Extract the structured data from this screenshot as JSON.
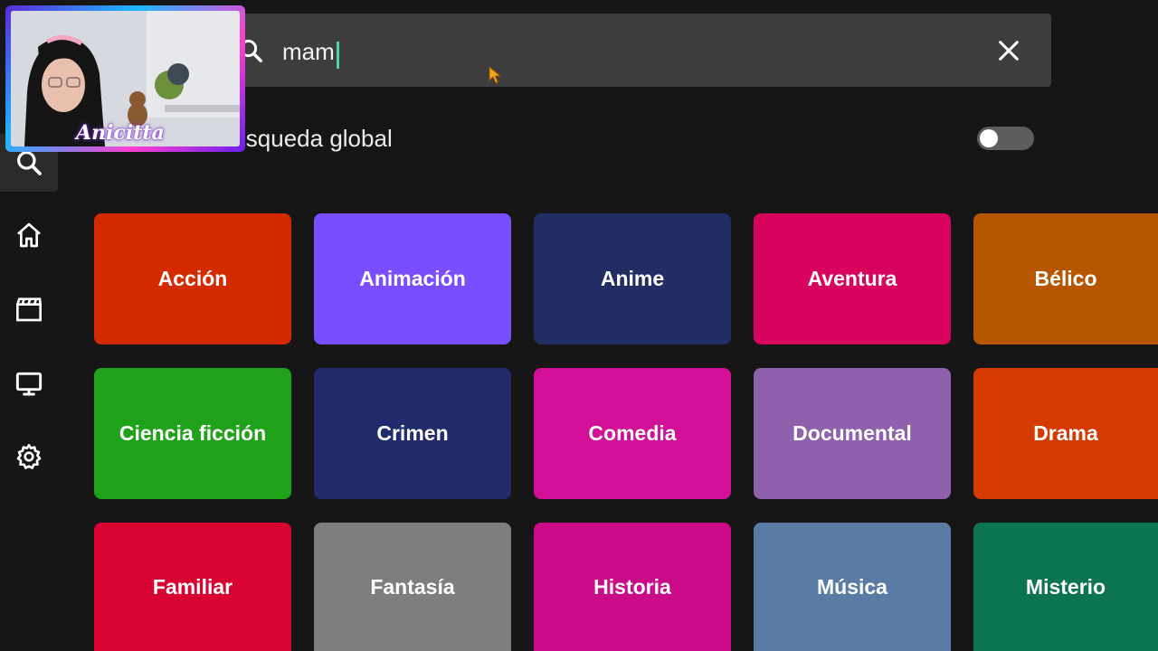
{
  "sidebar": {
    "items": [
      {
        "name": "search",
        "icon": "search-icon",
        "active": true
      },
      {
        "name": "home",
        "icon": "home-icon",
        "active": false
      },
      {
        "name": "movies",
        "icon": "clapperboard-icon",
        "active": false
      },
      {
        "name": "tv",
        "icon": "monitor-icon",
        "active": false
      },
      {
        "name": "settings",
        "icon": "gear-icon",
        "active": false
      }
    ]
  },
  "search": {
    "value": "mam",
    "icon": "search-icon",
    "clear_icon": "close-icon"
  },
  "global_search": {
    "label": "Búsqueda global",
    "enabled": false
  },
  "genres": [
    {
      "label": "Acción",
      "color": "#d42a00"
    },
    {
      "label": "Animación",
      "color": "#7a4dff"
    },
    {
      "label": "Anime",
      "color": "#222e63"
    },
    {
      "label": "Aventura",
      "color": "#d8035c"
    },
    {
      "label": "Bélico",
      "color": "#b65600"
    },
    {
      "label": "Ciencia ficción",
      "color": "#1fa21a"
    },
    {
      "label": "Crimen",
      "color": "#222b6c"
    },
    {
      "label": "Comedia",
      "color": "#d20f97"
    },
    {
      "label": "Documental",
      "color": "#8f61ad"
    },
    {
      "label": "Drama",
      "color": "#d53b00"
    },
    {
      "label": "Familiar",
      "color": "#d80332"
    },
    {
      "label": "Fantasía",
      "color": "#7e7e7e"
    },
    {
      "label": "Historia",
      "color": "#cb0b87"
    },
    {
      "label": "Música",
      "color": "#5a7ba3"
    },
    {
      "label": "Misterio",
      "color": "#0c7451"
    }
  ],
  "streamer": {
    "name": "Anicitta"
  }
}
